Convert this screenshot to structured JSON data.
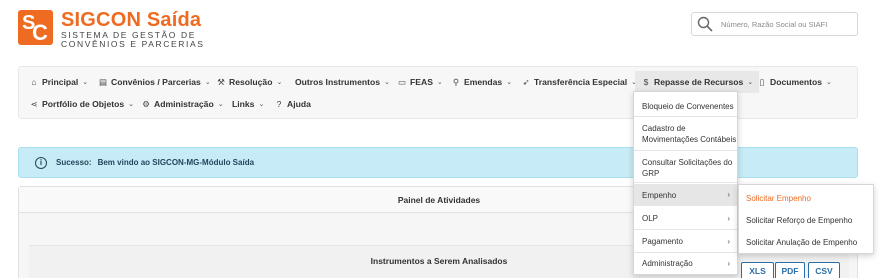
{
  "header": {
    "logo_letters": "SC",
    "title": "SIGCON Saída",
    "subtitle_line1": "SISTEMA DE GESTÃO DE",
    "subtitle_line2": "CONVÊNIOS E PARCERIAS",
    "brand_color": "#ee6b21"
  },
  "search": {
    "placeholder": "Número, Razão Social ou SIAFI",
    "icon": "search-icon"
  },
  "nav": {
    "items": [
      {
        "label": "Principal",
        "icon": "home-icon"
      },
      {
        "label": "Convênios / Parcerias",
        "icon": "document-list-icon"
      },
      {
        "label": "Resolução",
        "icon": "gavel-icon"
      },
      {
        "label": "Outros Instrumentos",
        "icon": ""
      },
      {
        "label": "FEAS",
        "icon": "folder-icon"
      },
      {
        "label": "Emendas",
        "icon": "user-icon"
      },
      {
        "label": "Transferência Especial",
        "icon": "paper-plane-icon"
      },
      {
        "label": "Repasse de Recursos",
        "icon": "dollar-icon"
      },
      {
        "label": "Documentos",
        "icon": "file-icon"
      },
      {
        "label": "Portfólio de Objetos",
        "icon": "share-icon"
      },
      {
        "label": "Administração",
        "icon": "gear-icon"
      },
      {
        "label": "Links",
        "icon": ""
      },
      {
        "label": "Ajuda",
        "icon": "question-icon"
      }
    ]
  },
  "alert": {
    "label": "Sucesso:",
    "message": "Bem vindo ao SIGCON-MG-Módulo Saída",
    "icon": "info-icon"
  },
  "panel": {
    "title": "Painel de Atividades",
    "section_title": "Instrumentos a Serem Analisados",
    "export_buttons": [
      "XLS",
      "PDF",
      "CSV"
    ]
  },
  "dropdown": {
    "items": [
      {
        "label_lines": [
          "Bloqueio de Convenentes"
        ]
      },
      {
        "label_lines": [
          "Cadastro de",
          "Movimentações Contábeis"
        ]
      },
      {
        "label_lines": [
          "Consultar Solicitações do",
          "GRP"
        ]
      },
      {
        "label_lines": [
          "Empenho"
        ],
        "has_submenu": true
      },
      {
        "label_lines": [
          "OLP"
        ],
        "has_submenu": true
      },
      {
        "label_lines": [
          "Pagamento"
        ],
        "has_submenu": true
      },
      {
        "label_lines": [
          "Administração"
        ],
        "has_submenu": true
      }
    ]
  },
  "submenu": {
    "items": [
      "Solicitar Empenho",
      "Solicitar Reforço de Empenho",
      "Solicitar Anulação de Empenho"
    ],
    "active_color": "#ee6b21"
  }
}
